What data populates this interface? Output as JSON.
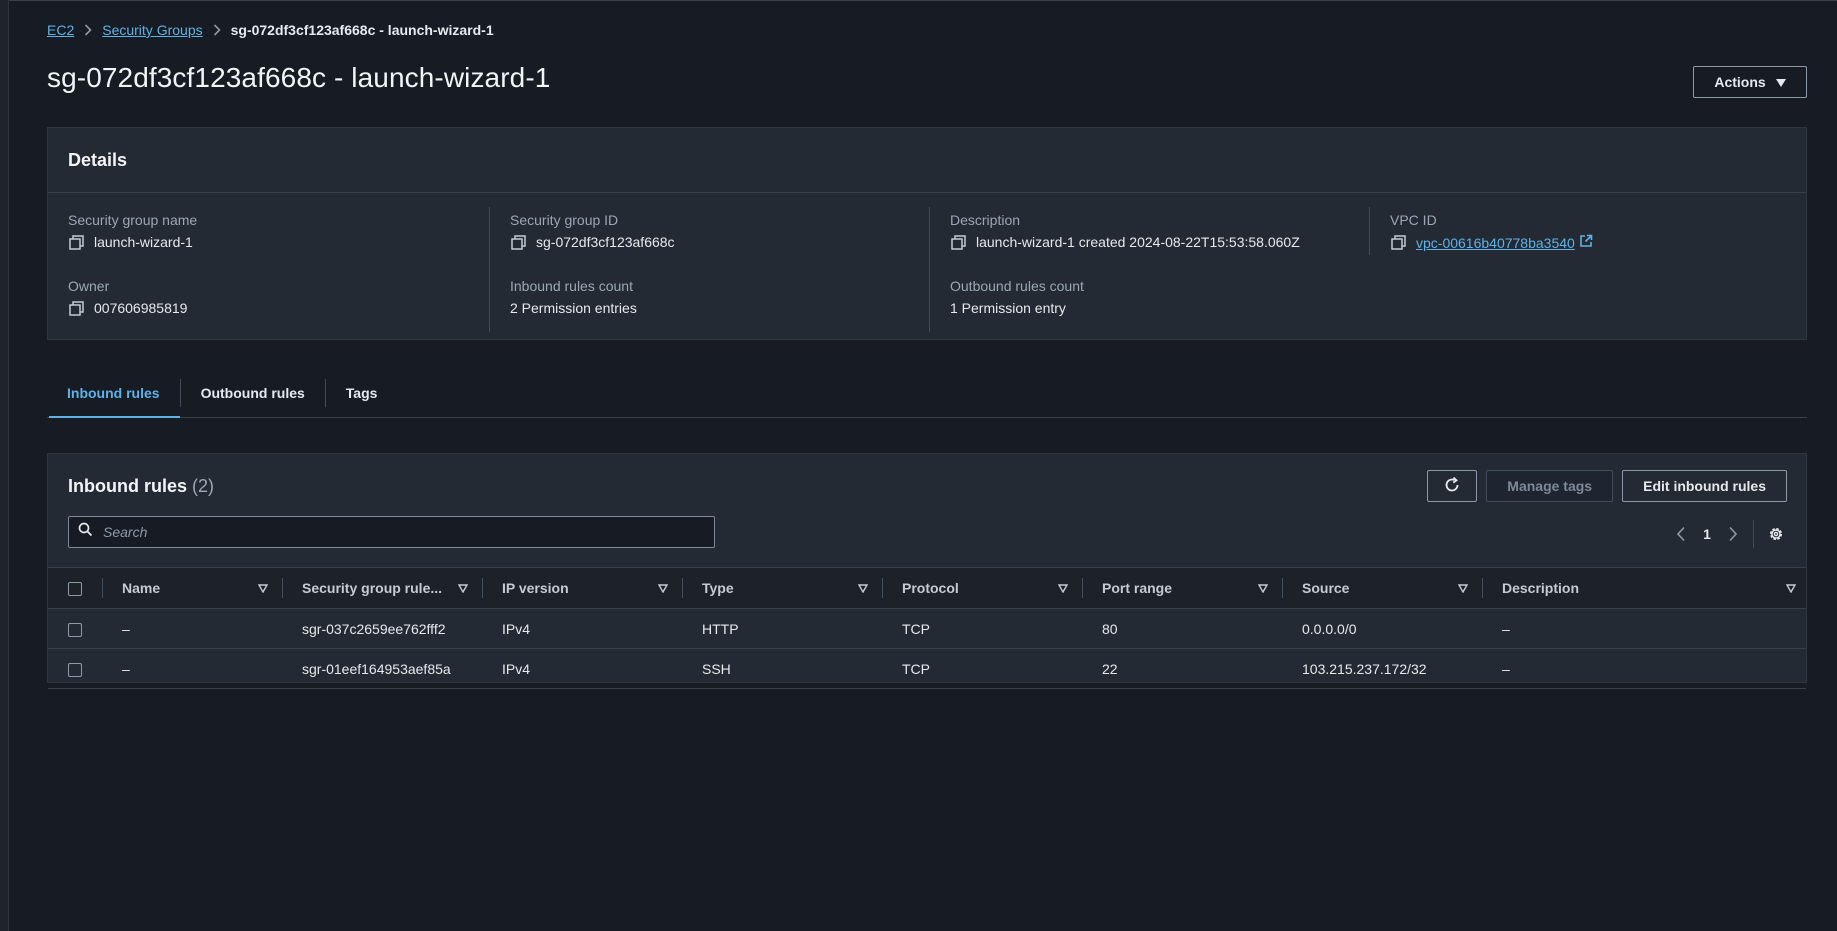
{
  "breadcrumb": {
    "items": [
      "EC2",
      "Security Groups"
    ],
    "current": "sg-072df3cf123af668c - launch-wizard-1"
  },
  "page_title": "sg-072df3cf123af668c - launch-wizard-1",
  "actions_button": "Actions",
  "details": {
    "title": "Details",
    "fields": {
      "sg_name": {
        "label": "Security group name",
        "value": "launch-wizard-1"
      },
      "sg_id": {
        "label": "Security group ID",
        "value": "sg-072df3cf123af668c"
      },
      "description": {
        "label": "Description",
        "value": "launch-wizard-1 created 2024-08-22T15:53:58.060Z"
      },
      "vpc_id": {
        "label": "VPC ID",
        "value": "vpc-00616b40778ba3540"
      },
      "owner": {
        "label": "Owner",
        "value": "007606985819"
      },
      "inbound_count": {
        "label": "Inbound rules count",
        "value": "2 Permission entries"
      },
      "outbound_count": {
        "label": "Outbound rules count",
        "value": "1 Permission entry"
      }
    }
  },
  "tabs": [
    "Inbound rules",
    "Outbound rules",
    "Tags"
  ],
  "inbound": {
    "title": "Inbound rules",
    "count": "(2)",
    "manage_tags": "Manage tags",
    "edit_rules": "Edit inbound rules",
    "search_placeholder": "Search",
    "page": "1",
    "columns": [
      "Name",
      "Security group rule...",
      "IP version",
      "Type",
      "Protocol",
      "Port range",
      "Source",
      "Description"
    ],
    "rows": [
      {
        "name": "–",
        "rule_id": "sgr-037c2659ee762fff2",
        "ip_version": "IPv4",
        "type": "HTTP",
        "protocol": "TCP",
        "port_range": "80",
        "source": "0.0.0.0/0",
        "description": "–"
      },
      {
        "name": "–",
        "rule_id": "sgr-01eef164953aef85a",
        "ip_version": "IPv4",
        "type": "SSH",
        "protocol": "TCP",
        "port_range": "22",
        "source": "103.215.237.172/32",
        "description": "–"
      }
    ]
  },
  "colors": {
    "background": "#161b24",
    "panel": "#242a33",
    "link": "#5fb1e6"
  }
}
